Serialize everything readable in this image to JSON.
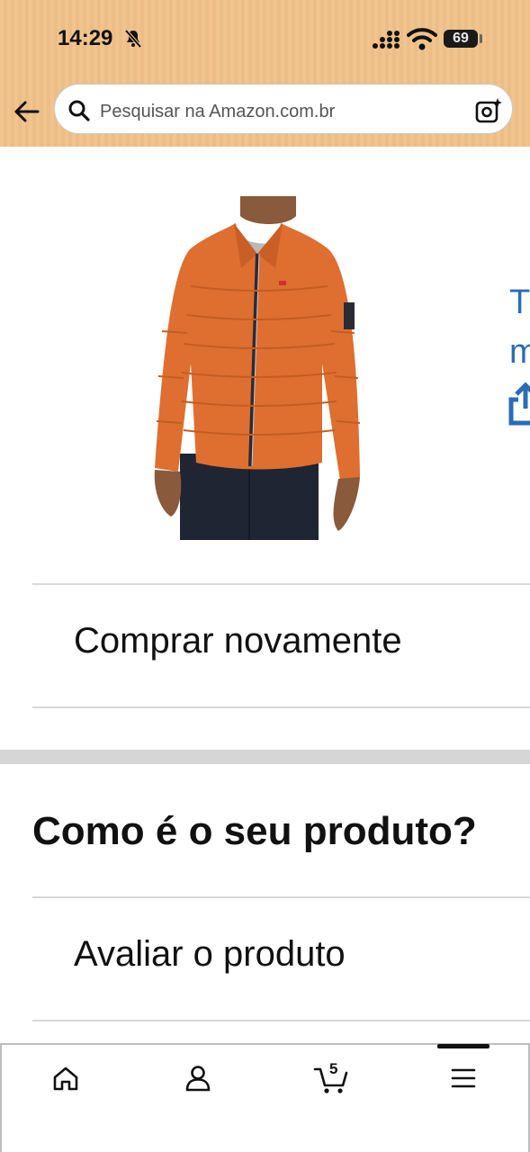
{
  "status_bar": {
    "time": "14:29",
    "battery": "69",
    "icons": [
      "bell-slash-icon",
      "signal-icon",
      "wifi-icon",
      "battery-icon"
    ]
  },
  "header": {
    "search_placeholder": "Pesquisar na Amazon.com.br",
    "icons": [
      "back-arrow-icon",
      "search-icon",
      "camera-search-icon"
    ],
    "background_color": "#f1c48e"
  },
  "product": {
    "image": "orange-puffer-jacket",
    "carousel_peek": [
      "T",
      "m"
    ],
    "peek_icon": "share-icon",
    "link_color": "#2a6db5"
  },
  "actions": {
    "buy_again": "Comprar novamente"
  },
  "review": {
    "title": "Como é o seu produto?",
    "rate_product": "Avaliar o produto"
  },
  "tabbar": {
    "items": [
      "home-icon",
      "account-icon",
      "cart-icon",
      "menu-icon"
    ],
    "cart_count": "5",
    "active": "menu-icon"
  }
}
